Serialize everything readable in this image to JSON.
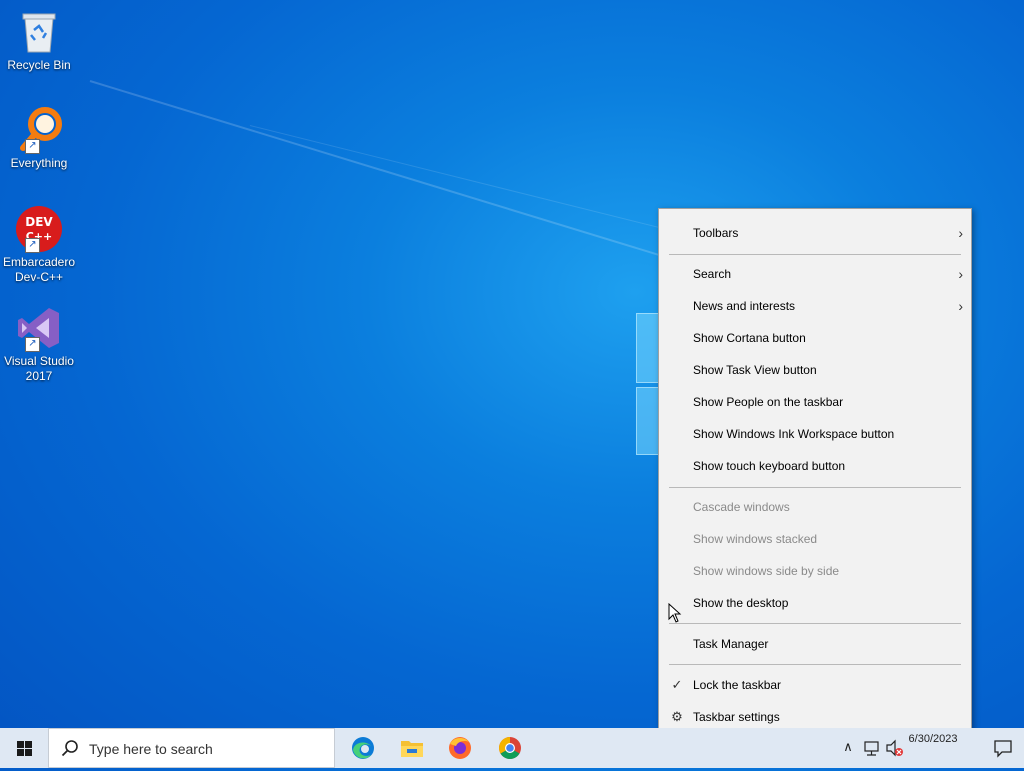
{
  "desktop": {
    "icons": [
      {
        "label": "Recycle Bin"
      },
      {
        "label": "Everything"
      },
      {
        "label": "Embarcadero Dev-C++"
      },
      {
        "label": "Visual Studio 2017"
      }
    ],
    "devcpp_badge": "DEV C++"
  },
  "context_menu": {
    "items": [
      {
        "label": "Toolbars",
        "submenu": true,
        "enabled": true
      },
      {
        "label": "Search",
        "submenu": true,
        "enabled": true
      },
      {
        "label": "News and interests",
        "submenu": true,
        "enabled": true
      },
      {
        "label": "Show Cortana button",
        "enabled": true
      },
      {
        "label": "Show Task View button",
        "enabled": true
      },
      {
        "label": "Show People on the taskbar",
        "enabled": true
      },
      {
        "label": "Show Windows Ink Workspace button",
        "enabled": true
      },
      {
        "label": "Show touch keyboard button",
        "enabled": true
      },
      {
        "label": "Cascade windows",
        "enabled": false
      },
      {
        "label": "Show windows stacked",
        "enabled": false
      },
      {
        "label": "Show windows side by side",
        "enabled": false
      },
      {
        "label": "Show the desktop",
        "enabled": true
      },
      {
        "label": "Task Manager",
        "enabled": true
      },
      {
        "label": "Lock the taskbar",
        "enabled": true,
        "checked": true
      },
      {
        "label": "Taskbar settings",
        "enabled": true,
        "icon": "gear-icon"
      }
    ],
    "arrow_glyph": "›",
    "check_glyph": "✓",
    "gear_glyph": "⚙"
  },
  "taskbar": {
    "search_placeholder": "Type here to search",
    "pinned_apps": [
      "edge-icon",
      "file-explorer-icon",
      "firefox-icon",
      "chrome-icon"
    ],
    "tray": {
      "chevron_glyph": "∧",
      "time": "",
      "date": "6/30/2023"
    }
  },
  "colors": {
    "desktop_blue": "#0567d2",
    "menu_bg": "#f2f2f2",
    "taskbar_bg": "#dfe8f3",
    "disabled_text": "#8a8a8a"
  }
}
